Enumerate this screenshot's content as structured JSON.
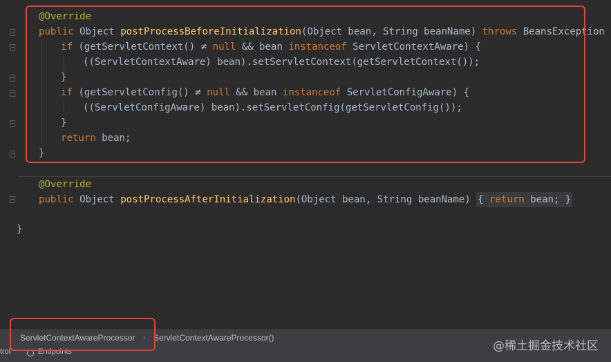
{
  "code": {
    "override_1": "@Override",
    "sig_1": {
      "public": "public ",
      "type": "Object ",
      "name": "postProcessBeforeInitialization",
      "params": "(Object bean, String beanName) ",
      "throws": "throws",
      "exception": " BeansException {"
    },
    "if_1": {
      "if": "if",
      "cond_a": " (getServletContext() ≠ ",
      "null": "null",
      "cond_b": " && bean ",
      "instanceof": "instanceof",
      "cond_c": " ServletContextAware) {"
    },
    "stmt_1": "((ServletContextAware) bean).setServletContext(getServletContext());",
    "close_1": "}",
    "if_2": {
      "if": "if",
      "cond_a": " (getServletConfig() ≠ ",
      "null": "null",
      "cond_b": " && bean ",
      "instanceof": "instanceof",
      "cond_c": " ServletConfigAware) {"
    },
    "stmt_2": "((ServletConfigAware) bean).setServletConfig(getServletConfig());",
    "close_2": "}",
    "return_1": {
      "kw": "return",
      "rest": " bean;"
    },
    "close_method_1": "}",
    "override_2": "@Override",
    "sig_2": {
      "public": "public ",
      "type": "Object ",
      "name": "postProcessAfterInitialization",
      "params": "(Object bean, String beanName) ",
      "open": "{",
      "return": "return",
      "body": " bean; ",
      "close": "}"
    },
    "class_close": "}"
  },
  "breadcrumb": {
    "class_name": "ServletContextAwareProcessor",
    "separator": "›",
    "member": "ServletContextAwareProcessor()"
  },
  "bottom_toolbar": {
    "left_item": "trol",
    "endpoints": "Endpoints"
  },
  "watermark": "@稀土掘金技术社区",
  "colors": {
    "background": "#2b2b2b",
    "keyword": "#cc7832",
    "annotation": "#bbb529",
    "method": "#ffc66d",
    "text": "#a9b7c6",
    "highlight": "#e0443a"
  }
}
